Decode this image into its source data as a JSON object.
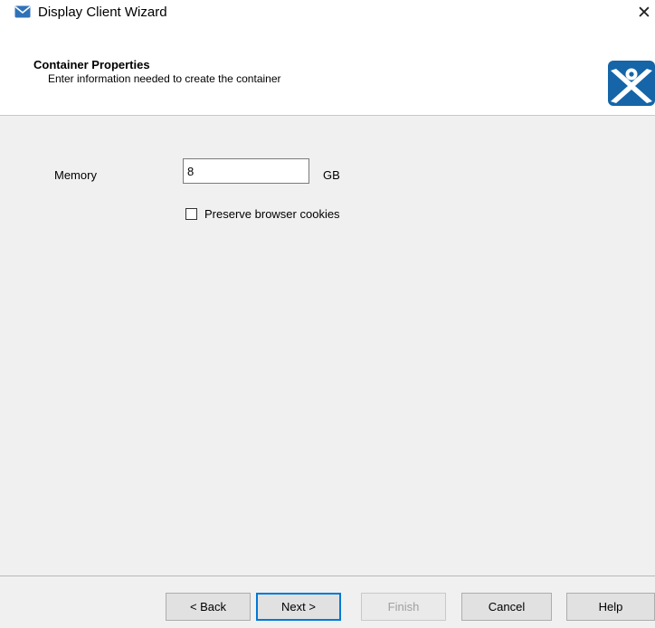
{
  "window": {
    "title": "Display Client Wizard",
    "close_symbol": "✕"
  },
  "header": {
    "title": "Container Properties",
    "subtitle": "Enter information needed to create the container"
  },
  "form": {
    "memory_label": "Memory",
    "memory_value": "8",
    "memory_unit": "GB",
    "preserve_cookies_label": "Preserve browser cookies",
    "preserve_cookies_checked": false
  },
  "buttons": {
    "back": "< Back",
    "next": "Next >",
    "finish": "Finish",
    "cancel": "Cancel",
    "help": "Help"
  },
  "icons": {
    "title_icon": "envelope-icon",
    "logo": "thinmanager-logo-icon"
  },
  "colors": {
    "logo_blue": "#1565a8",
    "default_button_border": "#0078d7"
  }
}
